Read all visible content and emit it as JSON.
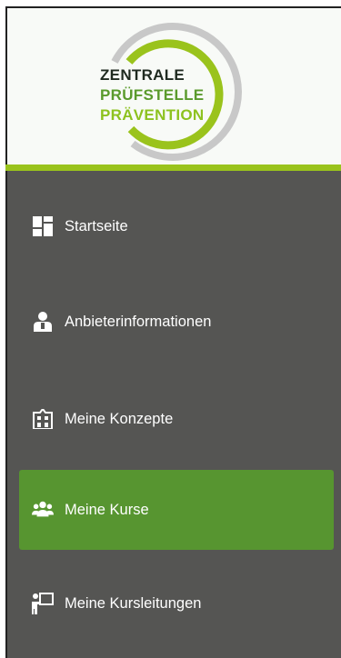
{
  "logo": {
    "line1": "ZENTRALE",
    "line2": "PRÜFSTELLE",
    "line3": "PRÄVENTION",
    "ring_color": "#9ac31c",
    "ring_gray": "#c8c8c8"
  },
  "sidebar": {
    "background": "#555553",
    "active_color": "#579530",
    "items": [
      {
        "label": "Startseite",
        "icon": "dashboard-icon",
        "active": false
      },
      {
        "label": "Anbieterinformationen",
        "icon": "provider-person-icon",
        "active": false
      },
      {
        "label": "Meine Konzepte",
        "icon": "building-icon",
        "active": false
      },
      {
        "label": "Meine Kurse",
        "icon": "group-icon",
        "active": true
      },
      {
        "label": "Meine Kursleitungen",
        "icon": "presenter-icon",
        "active": false
      }
    ]
  }
}
